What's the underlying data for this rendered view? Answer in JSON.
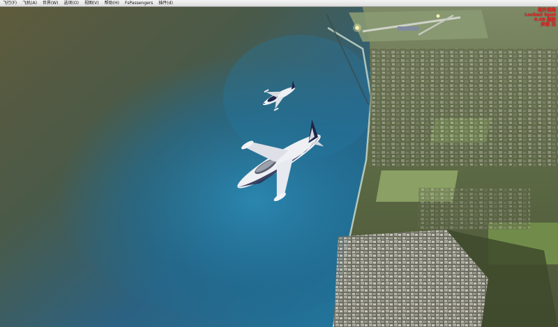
{
  "menu": {
    "items": [
      "飞行(F)",
      "飞机(A)",
      "世界(W)",
      "选项(O)",
      "视图(V)",
      "帮助(H)",
      "FsPassengers",
      "插件(d)"
    ]
  },
  "overlay": {
    "lines": [
      "视外视角",
      "Locked Spot",
      "0.48 缩放",
      "声音 关"
    ],
    "color": "#ff2a2a"
  },
  "colors": {
    "sea_brown": "#5c5a3a",
    "sea_blue": "#1f6c92",
    "land": "#6e7c56",
    "aircraft_body": "#eef0f4",
    "aircraft_stripe": "#1c2448"
  }
}
